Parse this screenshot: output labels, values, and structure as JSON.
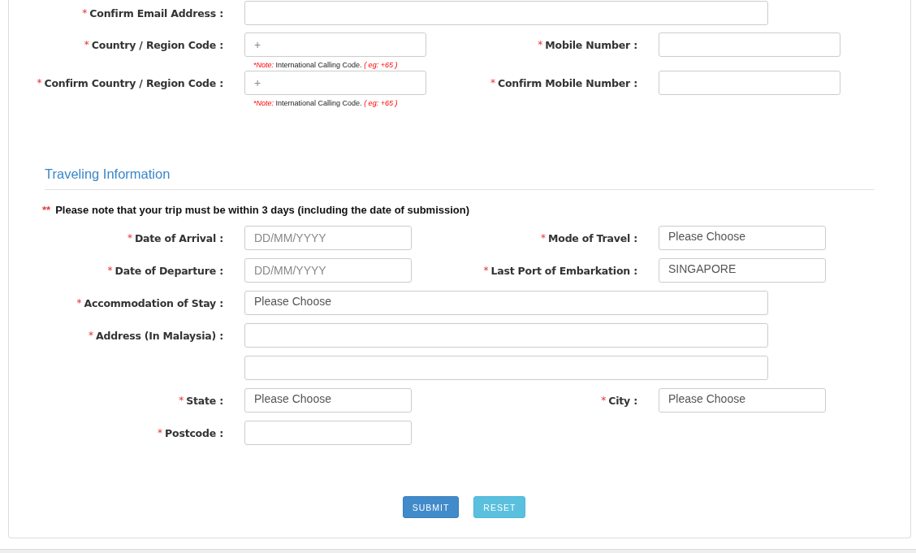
{
  "contact": {
    "rows": [
      {
        "left": {
          "marker": "*",
          "label": "Confirm Email Address :",
          "kind": "wide-input"
        }
      },
      {
        "left": {
          "marker": "*",
          "label": "Country / Region Code :",
          "kind": "input",
          "placeholder": "+",
          "note": {
            "lead": "*Note:",
            "text": "International Calling Code.",
            "example": "( eg: +65 )"
          }
        },
        "right": {
          "marker": "*",
          "label": "Mobile Number :",
          "kind": "input"
        }
      },
      {
        "left": {
          "marker": "*",
          "label": "Confirm Country / Region Code :",
          "kind": "input",
          "placeholder": "+",
          "note": {
            "lead": "*Note:",
            "text": "International Calling Code.",
            "example": "( eg: +65 )"
          }
        },
        "right": {
          "marker": "*",
          "label": "Confirm Mobile Number :",
          "kind": "input"
        }
      }
    ]
  },
  "travel": {
    "title": "Traveling Information",
    "notice": {
      "marker": "**",
      "text": "Please note that your trip must be within 3 days (including the date of submission)"
    },
    "rows": [
      {
        "left": {
          "marker": "*",
          "label": "Date of Arrival :",
          "kind": "short-input",
          "placeholder": "DD/MM/YYYY"
        },
        "right": {
          "marker": "*",
          "label": "Mode of Travel :",
          "kind": "short-select",
          "value": "Please Choose"
        }
      },
      {
        "left": {
          "marker": "*",
          "label": "Date of Departure :",
          "kind": "short-input",
          "placeholder": "DD/MM/YYYY"
        },
        "right": {
          "marker": "*",
          "label": "Last Port of Embarkation :",
          "kind": "short-select",
          "value": "SINGAPORE"
        }
      },
      {
        "left": {
          "marker": "*",
          "label": "Accommodation of Stay :",
          "kind": "wide-select",
          "value": "Please Choose"
        }
      },
      {
        "left": {
          "marker": "*",
          "label": "Address (In Malaysia) :",
          "kind": "wide-input"
        }
      },
      {
        "left": {
          "kind": "wide-input"
        }
      },
      {
        "left": {
          "marker": "*",
          "label": "State :",
          "kind": "short-select",
          "value": "Please Choose"
        },
        "right": {
          "marker": "*",
          "label": "City :",
          "kind": "short-select",
          "value": "Please Choose"
        }
      },
      {
        "left": {
          "marker": "*",
          "label": "Postcode :",
          "kind": "short-input"
        }
      }
    ]
  },
  "buttons": [
    {
      "label": "SUBMIT",
      "kind": "primary"
    },
    {
      "label": "RESET",
      "kind": "secondary"
    }
  ]
}
